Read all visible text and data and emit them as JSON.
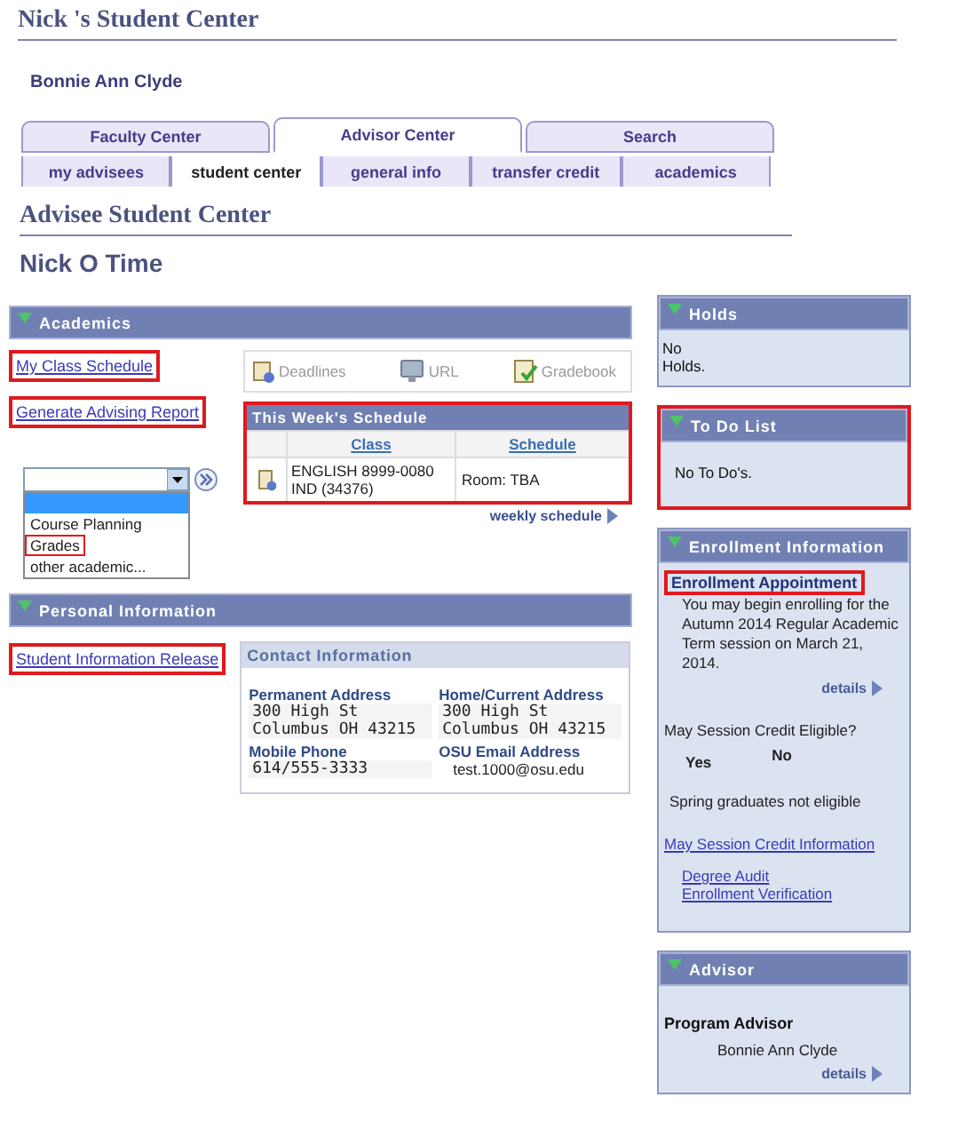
{
  "page_title": "Nick 's Student Center",
  "user_name": "Bonnie Ann Clyde",
  "tabs": [
    {
      "label": "Faculty Center",
      "selected": false
    },
    {
      "label": "Advisor Center",
      "selected": true
    },
    {
      "label": "Search",
      "selected": false
    }
  ],
  "subtabs": [
    {
      "label": "my advisees",
      "selected": false
    },
    {
      "label": "student center",
      "selected": true
    },
    {
      "label": "general info",
      "selected": false
    },
    {
      "label": "transfer credit",
      "selected": false
    },
    {
      "label": "academics",
      "selected": false
    }
  ],
  "section_title": "Advisee Student Center",
  "student_name": "Nick O Time",
  "academics": {
    "title": "Academics",
    "links": [
      {
        "label": "My Class Schedule",
        "highlighted": true
      },
      {
        "label": "Generate Advising Report",
        "highlighted": true
      }
    ],
    "toolbar": [
      {
        "label": "Deadlines",
        "kind": "deadlines"
      },
      {
        "label": "URL",
        "kind": "url"
      },
      {
        "label": "Gradebook",
        "kind": "gradebook"
      }
    ],
    "dropdown_options": [
      {
        "label": "Course Planning",
        "selected": false,
        "highlighted": false
      },
      {
        "label": "Grades",
        "selected": false,
        "highlighted": true
      },
      {
        "label": "other academic...",
        "selected": false,
        "highlighted": false
      }
    ],
    "schedule": {
      "title": "This Week's Schedule",
      "highlighted": true,
      "columns": [
        "Class",
        "Schedule"
      ],
      "rows": [
        {
          "class": "ENGLISH 8999-0080\nIND (34376)",
          "schedule": "Room:  TBA"
        }
      ]
    },
    "weekly_link": "weekly schedule"
  },
  "personal": {
    "title": "Personal Information",
    "links": [
      {
        "label": "Student Information Release",
        "highlighted": true
      }
    ],
    "contact_title": "Contact Information",
    "fields": [
      {
        "label": "Permanent Address",
        "lines": [
          "300 High St",
          "Columbus OH 43215"
        ],
        "kind": "mono"
      },
      {
        "label": "Home/Current Address",
        "lines": [
          "300 High St",
          "Columbus OH 43215"
        ],
        "kind": "mono"
      },
      {
        "label": "Mobile Phone",
        "lines": [
          "614/555-3333"
        ],
        "kind": "mono"
      },
      {
        "label": "OSU Email Address",
        "lines": [
          "test.1000@osu.edu"
        ],
        "kind": "plain"
      }
    ]
  },
  "holds": {
    "title": "Holds",
    "text": "No\nHolds.",
    "highlighted": false
  },
  "todo": {
    "title": "To Do List",
    "text": "No To Do's.",
    "highlighted": true
  },
  "enrollment": {
    "title": "Enrollment Information",
    "appointment_heading": "Enrollment Appointment",
    "heading_highlighted": true,
    "appointment_text": "You may begin enrolling for the Autumn 2014 Regular Academic Term session on March 21, 2014.",
    "details": "details",
    "question": "May Session Credit Eligible?",
    "answers": [
      "Yes",
      "No"
    ],
    "note": "Spring graduates not eligible",
    "info_link": "May Session Credit Information",
    "links": [
      "Degree Audit",
      "Enrollment Verification"
    ]
  },
  "advisor": {
    "title": "Advisor",
    "role": "Program Advisor",
    "name": "Bonnie Ann Clyde",
    "details": "details"
  }
}
